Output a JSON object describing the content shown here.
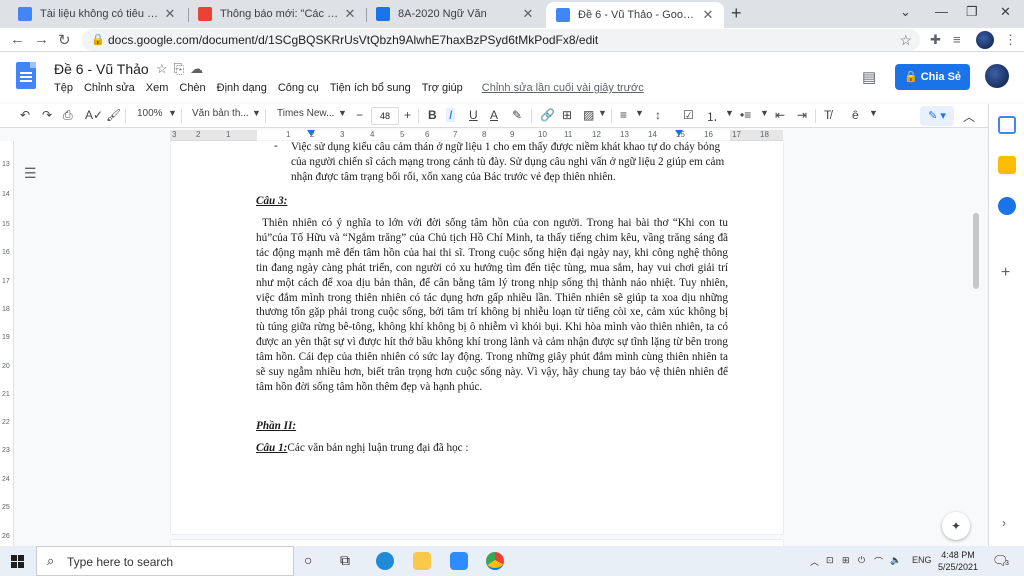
{
  "browser": {
    "tabs": [
      {
        "label": "Tài liệu không có tiêu đề - Google",
        "favicon_color": "#4285f4",
        "active": false
      },
      {
        "label": "Thông báo mới: \"Các con làm m",
        "favicon_color": "#ea4335",
        "active": false
      },
      {
        "label": "8A-2020 Ngữ Văn",
        "favicon_color": "#1a73e8",
        "active": false
      },
      {
        "label": "Đề 6 - Vũ Thảo - Google Tài liệu",
        "favicon_color": "#4285f4",
        "active": true
      }
    ],
    "new_tab_icon": "+",
    "url": "docs.google.com/document/d/1SCgBQSKRrUsVtQbzh9AlwhE7haxBzPSyd6tMkPodFx8/edit"
  },
  "docs": {
    "title": "Đề 6 - Vũ Thảo",
    "menu": [
      "Tệp",
      "Chỉnh sửa",
      "Xem",
      "Chèn",
      "Định dạng",
      "Công cụ",
      "Tiện ích bổ sung",
      "Trợ giúp"
    ],
    "last_edit": "Chỉnh sửa lần cuối vài giây trước",
    "share_label": "Chia Sẻ",
    "share_color": "#1a73e8"
  },
  "toolbar": {
    "zoom": "100%",
    "style": "Văn bản th...",
    "font": "Times New...",
    "font_size": "48"
  },
  "ruler": {
    "ticks": [
      "3",
      "2",
      "1",
      "1",
      "2",
      "3",
      "4",
      "5",
      "6",
      "7",
      "8",
      "9",
      "10",
      "11",
      "12",
      "13",
      "14",
      "15",
      "16",
      "17",
      "18"
    ]
  },
  "vruler": {
    "ticks": [
      "13",
      "14",
      "15",
      "16",
      "17",
      "18",
      "19",
      "20",
      "21",
      "22",
      "23",
      "24",
      "25",
      "26"
    ]
  },
  "document": {
    "bullet_text": "Việc sử dụng kiểu câu cảm thán ở ngữ liệu 1 cho em thấy được niềm khát khao tự do cháy bỏng của người chiến sĩ cách mạng trong cảnh tù đày. Sử dụng câu nghi vấn ở ngữ liệu 2 giúp em cảm nhận được tâm trạng bối rối, xốn xang của Bác trước vẻ đẹp thiên nhiên.",
    "heading_cau3": "Câu 3:",
    "paragraph": "Thiên nhiên có ý nghĩa to lớn với đời sống tâm hồn của con người. Trong hai bài thơ “Khi con tu hú”của Tố Hữu và “Ngắm trăng” của Chủ tịch Hồ Chí Minh, ta thấy tiếng chim kêu, vầng trăng sáng đã tác động mạnh mẽ đến tâm hồn của hai thi sĩ. Trong cuộc sống hiện đại ngày nay, khi công nghệ thông tin đang ngày càng phát triển, con người có xu hướng tìm đến tiệc tùng, mua sắm, hay vui chơi giải trí như một cách để xoa dịu bản thân, để cân bằng tâm lý trong nhịp sống thị thành náo nhiệt. Tuy nhiên, việc đắm mình trong thiên nhiên có tác dụng hơn gấp nhiều lần. Thiên nhiên sẽ giúp ta xoa dịu những thương tổn gặp phải trong cuộc sống, bởi tâm trí không bị nhiễu loạn từ tiếng còi xe, cảm xúc không bị tù túng giữa rừng bê-tông, không khí không bị ô nhiễm vì khói bụi. Khi hòa mình vào thiên nhiên, ta có được an yên thật sự vì được hít thở bầu không khí trong lành và cảm nhận được sự tĩnh lặng từ bên trong tâm hồn. Cái đẹp của thiên nhiên có sức lay động. Trong những giây phút đắm mình cùng thiên nhiên ta sẽ suy ngẫm nhiều hơn, biết trân trọng hơn cuộc sống này. Vì vậy, hãy chung tay bảo vệ thiên nhiên để tâm hồn đời sống tâm hồn thêm đẹp và hạnh phúc.",
    "heading_phan2": "Phần II:",
    "cau1_label": "Câu 1:",
    "cau1_text": "Các văn bản nghị luận trung đại đã học :"
  },
  "taskbar": {
    "search_placeholder": "Type here to search",
    "lang": "ENG",
    "time": "4:48 PM",
    "date": "5/25/2021",
    "notification_count": "3"
  }
}
